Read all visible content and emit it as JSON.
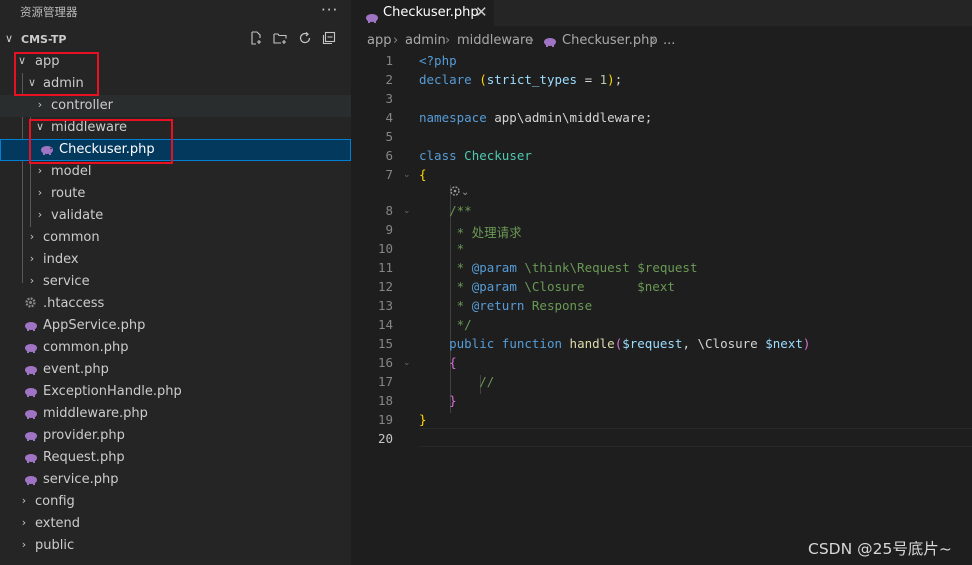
{
  "sidebar": {
    "title": "资源管理器",
    "more_icon": "ellipsis-icon",
    "project": {
      "label": "CMS-TP",
      "tools": [
        "new-file-icon",
        "new-folder-icon",
        "refresh-icon",
        "collapse-all-icon"
      ]
    },
    "tree": [
      {
        "label": "app",
        "type": "folder",
        "expanded": true
      },
      {
        "label": "admin",
        "type": "folder",
        "expanded": true
      },
      {
        "label": "controller",
        "type": "folder",
        "expanded": false
      },
      {
        "label": "middleware",
        "type": "folder",
        "expanded": true
      },
      {
        "label": "Checkuser.php",
        "type": "php",
        "selected": true
      },
      {
        "label": "model",
        "type": "folder",
        "expanded": false
      },
      {
        "label": "route",
        "type": "folder",
        "expanded": false
      },
      {
        "label": "validate",
        "type": "folder",
        "expanded": false
      },
      {
        "label": "common",
        "type": "folder",
        "expanded": false
      },
      {
        "label": "index",
        "type": "folder",
        "expanded": false
      },
      {
        "label": "service",
        "type": "folder",
        "expanded": false
      },
      {
        "label": ".htaccess",
        "type": "config"
      },
      {
        "label": "AppService.php",
        "type": "php"
      },
      {
        "label": "common.php",
        "type": "php"
      },
      {
        "label": "event.php",
        "type": "php"
      },
      {
        "label": "ExceptionHandle.php",
        "type": "php"
      },
      {
        "label": "middleware.php",
        "type": "php"
      },
      {
        "label": "provider.php",
        "type": "php"
      },
      {
        "label": "Request.php",
        "type": "php"
      },
      {
        "label": "service.php",
        "type": "php"
      },
      {
        "label": "config",
        "type": "folder",
        "expanded": false
      },
      {
        "label": "extend",
        "type": "folder",
        "expanded": false
      },
      {
        "label": "public",
        "type": "folder",
        "expanded": false
      }
    ]
  },
  "editor": {
    "tab": {
      "label": "Checkuser.php",
      "close": "✕"
    },
    "breadcrumb": [
      "app",
      "admin",
      "middleware",
      "Checkuser.php",
      "..."
    ],
    "line_numbers": [
      "1",
      "2",
      "3",
      "4",
      "5",
      "6",
      "7",
      "8",
      "9",
      "10",
      "11",
      "12",
      "13",
      "14",
      "15",
      "16",
      "17",
      "18",
      "19",
      "20"
    ],
    "current_line": "20"
  },
  "watermark": "CSDN @25号底片~",
  "colors": {
    "sidebar_bg": "#252526",
    "editor_bg": "#1e1e1e",
    "selection": "#04395e",
    "highlight_box": "#e81123",
    "php_icon": "#a074c4"
  }
}
